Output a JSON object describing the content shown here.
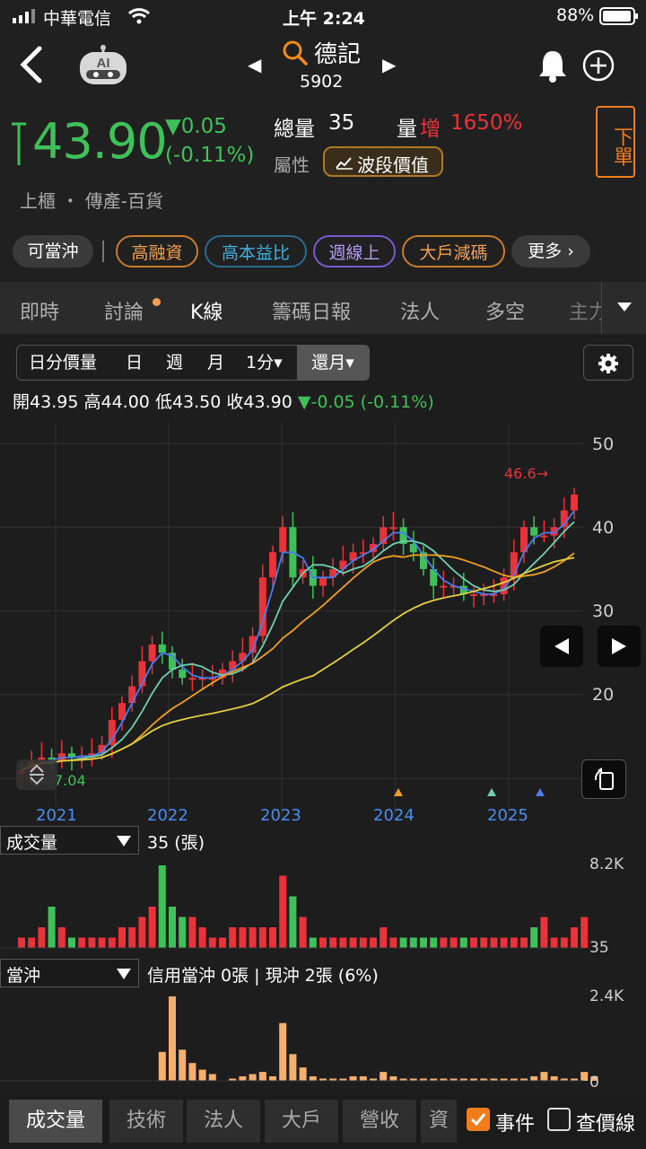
{
  "status": {
    "carrier": "中華電信",
    "time": "上午 2:24",
    "battery": "88%"
  },
  "stock": {
    "name": "德記",
    "code": "5902",
    "price": "43.90",
    "change": "▼0.05",
    "change_pct": "(-0.11%)",
    "total_vol_label": "總量",
    "total_vol": "35",
    "vol_inc_label": "量",
    "vol_inc_word": "增",
    "vol_inc_pct": "1650%",
    "attr_label": "屬性",
    "attr_btn": "波段價值",
    "order_label": "下單",
    "market": "上櫃 ・ 傳產-百貨"
  },
  "tags": [
    "可當沖",
    "高融資",
    "高本益比",
    "週線上",
    "大戶減碼",
    "更多 ›"
  ],
  "tabs": [
    "即時",
    "討論",
    "K線",
    "籌碼日報",
    "法人",
    "多空",
    "主力"
  ],
  "chart_controls": {
    "segments": [
      "日分價量",
      "日",
      "週",
      "月",
      "1分▾"
    ],
    "active": "還月▾"
  },
  "ohlc": {
    "open_label": "開",
    "open": "43.95",
    "high_label": "高",
    "high": "44.00",
    "low_label": "低",
    "low": "43.50",
    "close_label": "收",
    "close": "43.90",
    "chg": "▼-0.05 (-0.11%)"
  },
  "y_ticks": [
    "50",
    "40",
    "30",
    "20"
  ],
  "years": [
    "2021",
    "2022",
    "2023",
    "2024",
    "2025"
  ],
  "annotations": {
    "high_mark": "46.6→",
    "low_mark": "7.04"
  },
  "vol_panel": {
    "selector": "成交量",
    "value": "35 (張)",
    "max": "8.2K",
    "min": "35"
  },
  "dt_panel": {
    "selector": "當沖",
    "desc": "信用當沖 0張 | 現沖 2張 (6%)",
    "max": "2.4K",
    "min": "0"
  },
  "bottom_tabs": [
    "成交量",
    "技術",
    "法人",
    "大戶",
    "營收",
    "資"
  ],
  "checks": {
    "event": "事件",
    "price_line": "查價線"
  },
  "chart_data": {
    "type": "bar",
    "title": "",
    "ylim": [
      10,
      50
    ],
    "x": [
      "2021",
      "2022",
      "2023",
      "2024",
      "2025"
    ],
    "series": [
      {
        "values": [
          11,
          12,
          12.5,
          12,
          13,
          12.5,
          12.5,
          13,
          14,
          17,
          19,
          21,
          24,
          26,
          25,
          23,
          22,
          22,
          22,
          22,
          23,
          24,
          25,
          27,
          34,
          37,
          40,
          34,
          35,
          33,
          34,
          35,
          36,
          37,
          37,
          38,
          40,
          40,
          38,
          37,
          35,
          33,
          33,
          33,
          32,
          32,
          32,
          32,
          34,
          37,
          40,
          39,
          39,
          40,
          42,
          43.9
        ]
      },
      {
        "name": "成交量",
        "values": [
          1,
          1,
          2,
          4,
          2,
          1,
          1,
          1,
          1,
          1,
          2,
          2,
          3,
          4,
          8,
          4,
          3,
          3,
          2,
          1,
          1,
          2,
          2,
          2,
          2,
          2,
          7,
          5,
          3,
          1,
          1,
          1,
          1,
          1,
          1,
          1,
          2,
          1,
          1,
          1,
          1,
          1,
          1,
          1,
          1,
          1,
          1,
          1,
          1,
          1,
          1,
          2,
          3,
          1,
          1,
          2,
          3
        ]
      },
      {
        "name": "當沖",
        "values": [
          0,
          0,
          0,
          0,
          0,
          0,
          0,
          0,
          0,
          0,
          0,
          0,
          0,
          0,
          0.65,
          1.9,
          0.7,
          0.4,
          0.25,
          0.15,
          0,
          0.05,
          0.1,
          0.15,
          0.2,
          0.1,
          1.3,
          0.6,
          0.3,
          0.1,
          0.05,
          0.05,
          0.05,
          0.1,
          0.1,
          0.05,
          0.2,
          0.1,
          0.05,
          0.05,
          0.05,
          0.05,
          0.05,
          0.05,
          0.05,
          0.05,
          0.05,
          0.05,
          0.05,
          0.05,
          0.05,
          0.1,
          0.2,
          0.1,
          0.05,
          0.05,
          0.2,
          0.1
        ]
      }
    ]
  }
}
